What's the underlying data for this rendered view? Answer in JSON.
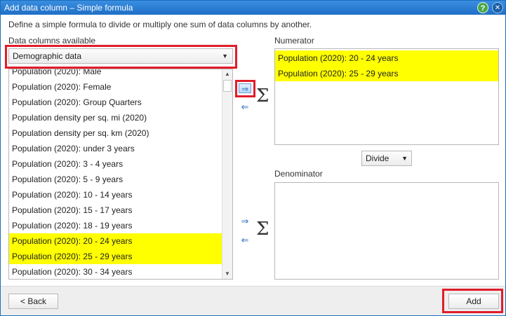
{
  "window": {
    "title": "Add data column – Simple formula",
    "help_glyph": "?",
    "close_glyph": "✕"
  },
  "description": "Define a simple formula to divide or multiply one sum of data columns by another.",
  "left": {
    "label": "Data columns available",
    "category": "Demographic data",
    "items": [
      {
        "label": "Population (2020): Male",
        "selected": false
      },
      {
        "label": "Population (2020): Female",
        "selected": false
      },
      {
        "label": "Population (2020): Group Quarters",
        "selected": false
      },
      {
        "label": "Population density per sq. mi (2020)",
        "selected": false
      },
      {
        "label": "Population density per sq. km (2020)",
        "selected": false
      },
      {
        "label": "Population (2020): under 3 years",
        "selected": false
      },
      {
        "label": "Population (2020): 3 - 4 years",
        "selected": false
      },
      {
        "label": "Population (2020): 5 - 9 years",
        "selected": false
      },
      {
        "label": "Population (2020): 10 - 14 years",
        "selected": false
      },
      {
        "label": "Population (2020): 15 - 17 years",
        "selected": false
      },
      {
        "label": "Population (2020): 18 - 19 years",
        "selected": false
      },
      {
        "label": "Population (2020): 20 - 24 years",
        "selected": true
      },
      {
        "label": "Population (2020): 25 - 29 years",
        "selected": true
      },
      {
        "label": "Population (2020): 30 - 34 years",
        "selected": false
      }
    ]
  },
  "numerator": {
    "label": "Numerator",
    "items": [
      "Population (2020): 20 - 24 years",
      "Population (2020): 25 - 29 years"
    ]
  },
  "operator": {
    "value": "Divide"
  },
  "denominator": {
    "label": "Denominator",
    "items": []
  },
  "glyphs": {
    "add_arrow": "⇒",
    "remove_arrow": "⇐",
    "sigma": "Σ",
    "dropdown": "▼",
    "scroll_up": "▲",
    "scroll_down": "▼"
  },
  "footer": {
    "back_label": "< Back",
    "add_label": "Add"
  },
  "colors": {
    "highlight": "#ffff00",
    "annotation": "#e21c2a",
    "titlebar": "#1f6fc6"
  }
}
